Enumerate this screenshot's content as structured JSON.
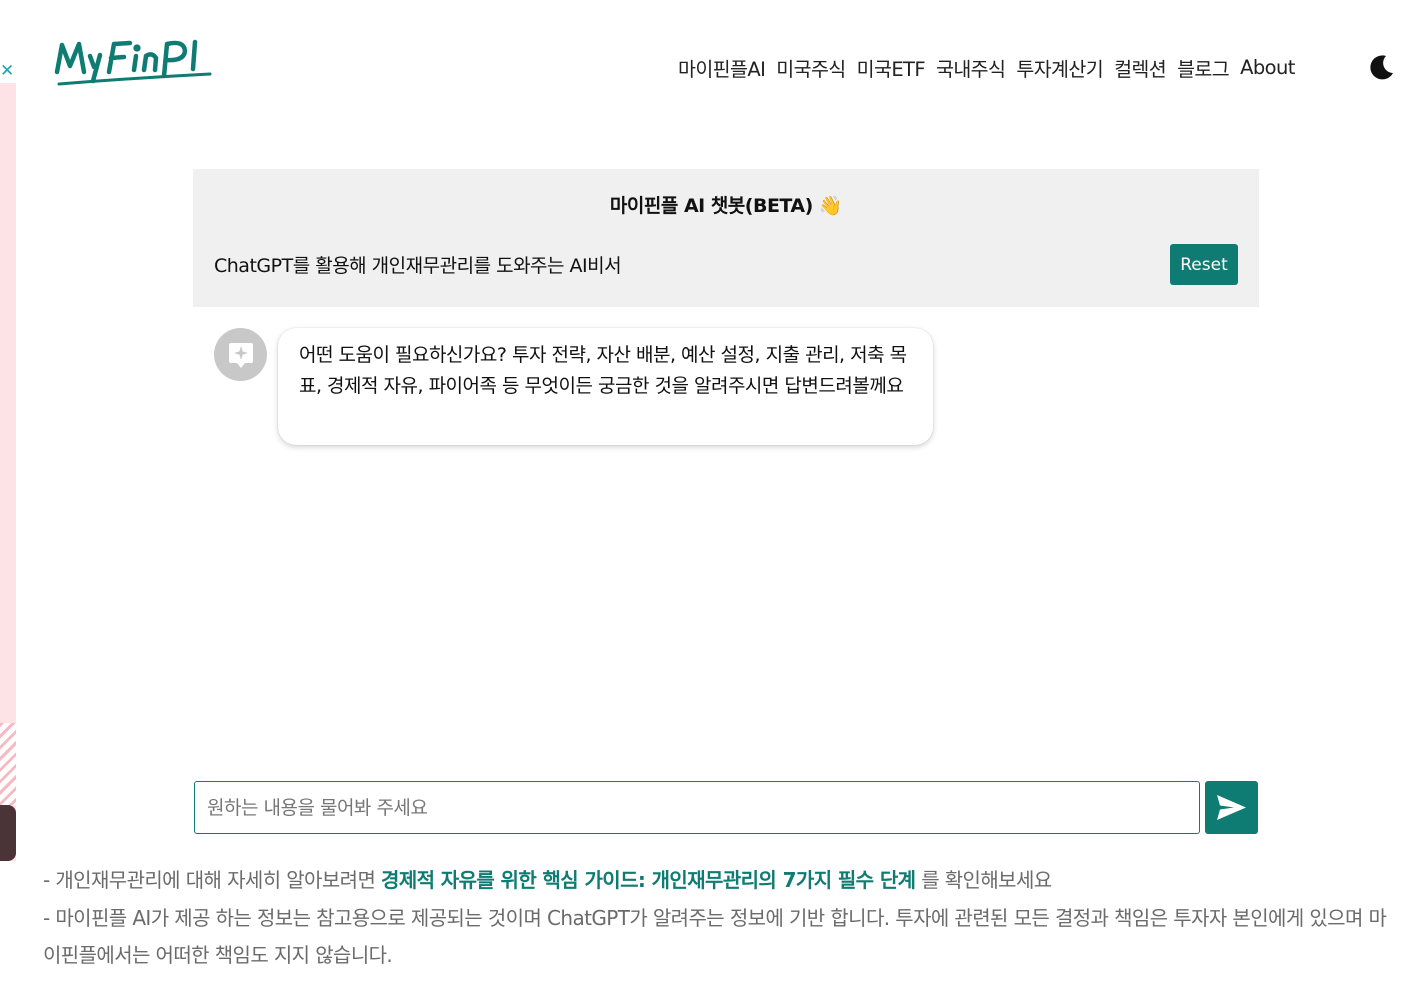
{
  "brand": {
    "logo_text": "MyFinPl",
    "accent_color": "#0e7c72"
  },
  "nav": {
    "items": [
      "마이핀플AI",
      "미국주식",
      "미국ETF",
      "국내주식",
      "투자계산기",
      "컬렉션",
      "블로그",
      "About"
    ],
    "theme_toggle_icon": "moon-icon"
  },
  "ad": {
    "close_glyph": "✕"
  },
  "chat": {
    "title": "마이핀플 AI 챗봇(BETA) 👋",
    "subtitle": "ChatGPT를 활용해 개인재무관리를 도와주는 AI비서",
    "reset_label": "Reset",
    "messages": [
      {
        "role": "assistant",
        "avatar_icon": "ai-sparkle-icon",
        "text": "어떤 도움이 필요하신가요? 투자 전략, 자산 배분, 예산 설정, 지출 관리, 저축 목표, 경제적 자유, 파이어족 등 무엇이든 궁금한 것을 알려주시면 답변드려볼께요"
      }
    ],
    "input_placeholder": "원하는 내용을 물어봐 주세요",
    "send_icon": "send-arrow-icon"
  },
  "notes": {
    "line1_prefix": "- 개인재무관리에 대해 자세히 알아보려면 ",
    "line1_link": "경제적 자유를 위한 핵심 가이드: 개인재무관리의 7가지 필수 단계",
    "line1_suffix": " 를 확인해보세요",
    "line2": "- 마이핀플 AI가 제공 하는 정보는 참고용으로 제공되는 것이며 ChatGPT가 알려주는 정보에 기반 합니다. 투자에 관련된 모든 결정과 책임은 투자자 본인에게 있으며 마이핀플에서는 어떠한 책임도 지지 않습니다."
  }
}
